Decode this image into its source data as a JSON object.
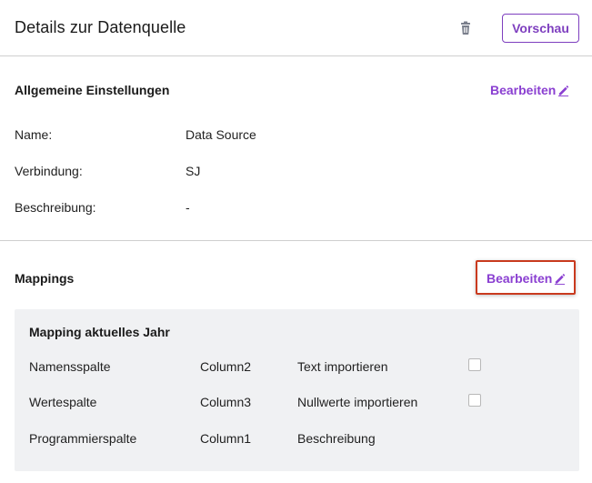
{
  "header": {
    "title": "Details zur Datenquelle",
    "preview_label": "Vorschau"
  },
  "general": {
    "title": "Allgemeine Einstellungen",
    "edit_label": "Bearbeiten",
    "fields": [
      {
        "label": "Name:",
        "value": "Data Source"
      },
      {
        "label": "Verbindung:",
        "value": "SJ"
      },
      {
        "label": "Beschreibung:",
        "value": "-"
      }
    ]
  },
  "mappings": {
    "title": "Mappings",
    "edit_label": "Bearbeiten",
    "panel": {
      "title": "Mapping aktuelles Jahr",
      "rows": [
        {
          "label": "Namensspalte",
          "value": "Column2",
          "option": "Text importieren",
          "checked": false
        },
        {
          "label": "Wertespalte",
          "value": "Column3",
          "option": "Nullwerte importieren",
          "checked": false
        },
        {
          "label": "Programmierspalte",
          "value": "Column1",
          "option": "Beschreibung"
        }
      ]
    }
  },
  "colors": {
    "accent": "#8a3fd1",
    "highlight_border": "#c93a1e",
    "panel_bg": "#f0f1f3"
  }
}
